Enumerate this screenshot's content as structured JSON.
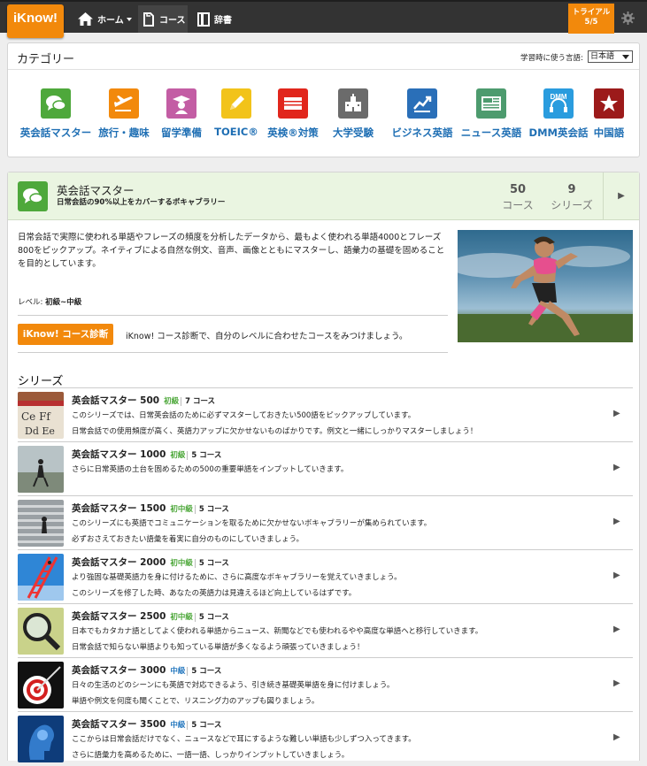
{
  "nav": {
    "logo": "iKnow!",
    "home": "ホーム",
    "course": "コース",
    "dictionary": "辞書",
    "trial_label": "トライアル",
    "trial_count": "5/5"
  },
  "categories": {
    "title": "カテゴリー",
    "lang_label": "学習時に使う言語:",
    "lang_value": "日本語",
    "items": [
      {
        "label": "英会話マスター",
        "icon": "speech-bubbles-icon",
        "color": "#4ea83b"
      },
      {
        "label": "旅行・趣味",
        "icon": "airplane-icon",
        "color": "#f2890c"
      },
      {
        "label": "留学準備",
        "icon": "graduate-icon",
        "color": "#c35da4"
      },
      {
        "label": "TOEIC®",
        "icon": "pencil-icon",
        "color": "#f2c31a"
      },
      {
        "label": "英検®対策",
        "icon": "book-icon",
        "color": "#e1261c"
      },
      {
        "label": "大学受験",
        "icon": "school-building-icon",
        "color": "#6b6b6b"
      },
      {
        "label": "ビジネス英語",
        "icon": "growth-chart-icon",
        "color": "#2a6fb8"
      },
      {
        "label": "ニュース英語",
        "icon": "newspaper-icon",
        "color": "#4d9b6e"
      },
      {
        "label": "DMM英会話",
        "icon": "dmm-headset-icon",
        "color": "#2a9cde"
      },
      {
        "label": "中国語",
        "icon": "star-icon",
        "color": "#9c1a1a"
      }
    ]
  },
  "course": {
    "title": "英会話マスター",
    "subtitle": "日常会話の90%以上をカバーするボキャブラリー",
    "course_count": "50",
    "course_label": "コース",
    "series_count": "9",
    "series_label": "シリーズ",
    "description": "日常会話で実際に使われる単語やフレーズの頻度を分析したデータから、最もよく使われる単語4000とフレーズ800をピックアップ。ネイティブによる自然な例文、音声、画像とともにマスターし、語彙力の基礎を固めることを目的としています。",
    "level_label": "レベル:",
    "level_value": "初級~中級",
    "diag_button": "iKnow! コース診断",
    "diag_text": "iKnow! コース診断で、自分のレベルに合わせたコースをみつけましょう。"
  },
  "series": {
    "title": "シリーズ",
    "items": [
      {
        "name": "英会話マスター 500",
        "level": "初級",
        "level_type": "beg",
        "count": "7 コース",
        "line1": "このシリーズでは、日常英会話のために必ずマスターしておきたい500語をピックアップしています。",
        "line2": "日常会話での使用頻度が高く、英語力アップに欠かせないものばかりです。例文と一緒にしっかりマスターしましょう！"
      },
      {
        "name": "英会話マスター 1000",
        "level": "初級",
        "level_type": "beg",
        "count": "5 コース",
        "line1": "さらに日常英語の土台を固めるための500の重要単語をインプットしていきます。",
        "line2": ""
      },
      {
        "name": "英会話マスター 1500",
        "level": "初中級",
        "level_type": "beg",
        "count": "5 コース",
        "line1": "このシリーズにも英語でコミュニケーションを取るために欠かせないボキャブラリーが集められています。",
        "line2": "必ずおさえておきたい語彙を着実に自分のものにしていきましょう。"
      },
      {
        "name": "英会話マスター 2000",
        "level": "初中級",
        "level_type": "beg",
        "count": "5 コース",
        "line1": "より強固な基礎英語力を身に付けるために、さらに高度なボキャブラリーを覚えていきましょう。",
        "line2": "このシリーズを修了した時、あなたの英語力は見違えるほど向上しているはずです。"
      },
      {
        "name": "英会話マスター 2500",
        "level": "初中級",
        "level_type": "beg",
        "count": "5 コース",
        "line1": "日本でもカタカナ語としてよく使われる単語からニュース、新聞などでも使われるやや高度な単語へと移行していきます。",
        "line2": "日常会話で知らない単語よりも知っている単語が多くなるよう頑張っていきましょう！"
      },
      {
        "name": "英会話マスター 3000",
        "level": "中級",
        "level_type": "mid",
        "count": "5 コース",
        "line1": "日々の生活のどのシーンにも英語で対応できるよう、引き続き基礎英単語を身に付けましょう。",
        "line2": "単語や例文を何度も聞くことで、リスニング力のアップも図りましょう。"
      },
      {
        "name": "英会話マスター 3500",
        "level": "中級",
        "level_type": "mid",
        "count": "5 コース",
        "line1": "ここからは日常会話だけでなく、ニュースなどで耳にするような難しい単語も少しずつ入ってきます。",
        "line2": "さらに語彙力を高めるために、一語一語、しっかりインプットしていきましょう。"
      }
    ]
  }
}
